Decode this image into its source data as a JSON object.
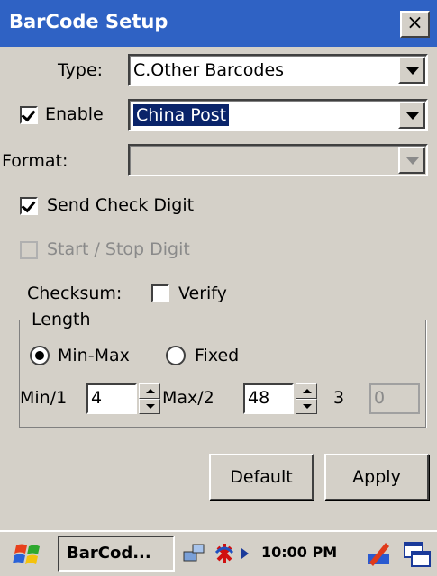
{
  "window": {
    "title": "BarCode Setup",
    "close_label": "×"
  },
  "type": {
    "label": "Type:",
    "value": "C.Other Barcodes"
  },
  "enable": {
    "label": "Enable",
    "checked": true,
    "value": "China Post"
  },
  "format": {
    "label": "Format:",
    "value": ""
  },
  "send_check_digit": {
    "label": "Send Check Digit",
    "checked": true
  },
  "start_stop_digit": {
    "label": "Start / Stop Digit",
    "checked": false
  },
  "checksum": {
    "label": "Checksum:",
    "verify_label": "Verify",
    "checked": false
  },
  "length": {
    "group_label": "Length",
    "mode_minmax_label": "Min-Max",
    "mode_fixed_label": "Fixed",
    "selected_mode": "Min-Max",
    "min_label": "Min/1",
    "min_value": "4",
    "max_label": "Max/2",
    "max_value": "48",
    "third_label": "3",
    "third_value": "0"
  },
  "buttons": {
    "default_label": "Default",
    "apply_label": "Apply"
  },
  "taskbar": {
    "task_label": "BarCod...",
    "clock": "10:00 PM"
  },
  "colors": {
    "title_bar": "#2f62c4",
    "selection": "#0a246a",
    "face": "#d4d0c8"
  }
}
